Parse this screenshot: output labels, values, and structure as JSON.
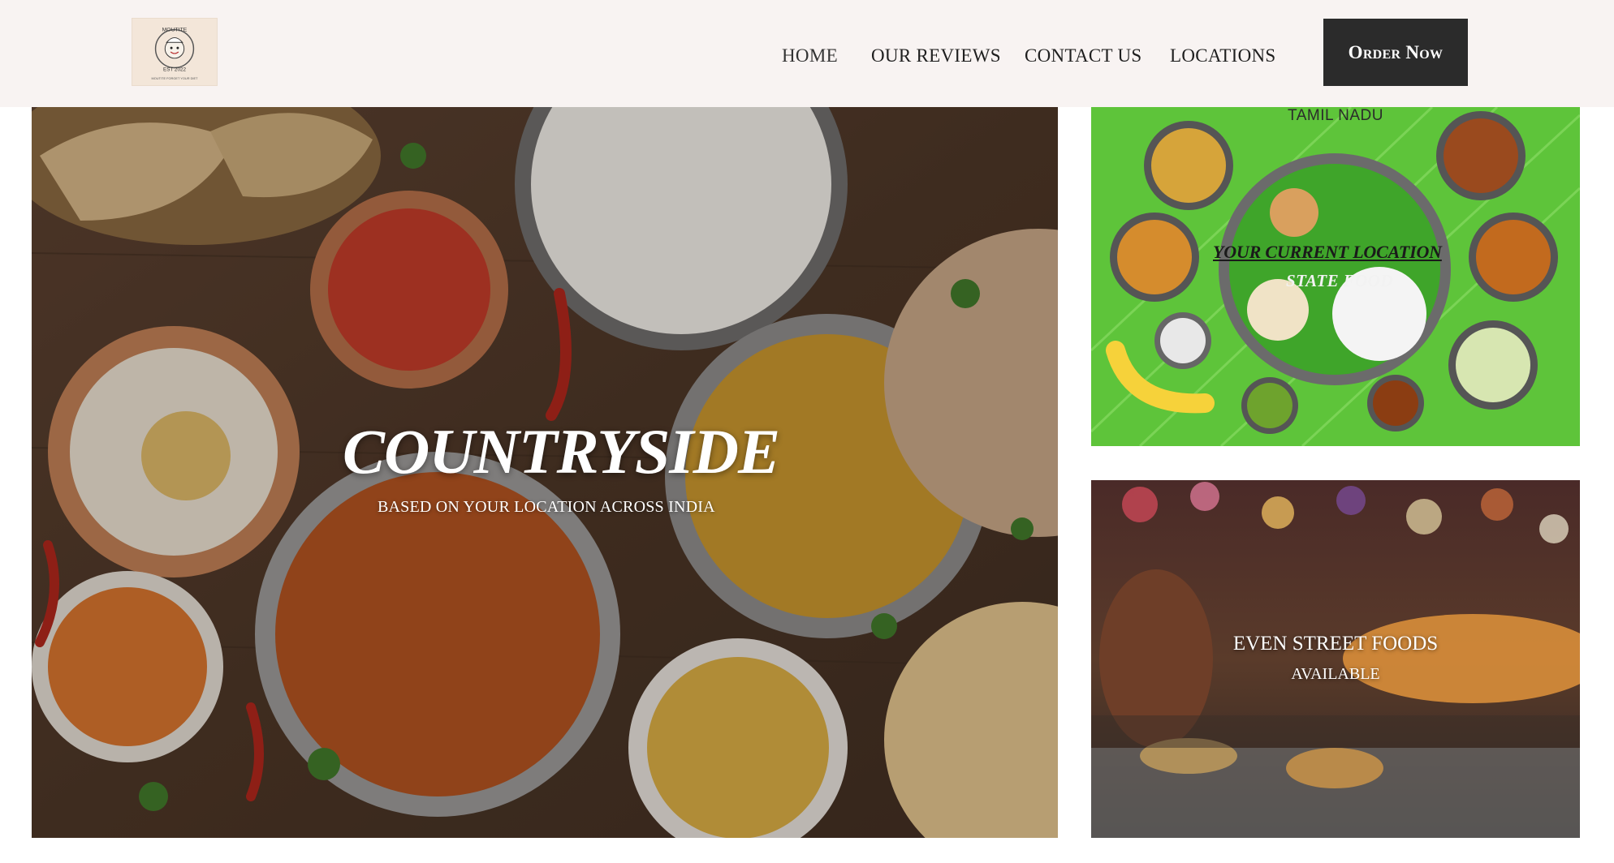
{
  "header": {
    "logo_lines": [
      "MOUTITE",
      "EST 2022",
      "MOUTITE FORGET YOUR DIET"
    ],
    "nav": [
      "HOME",
      "OUR REVIEWS",
      "CONTACT US",
      "LOCATIONS"
    ],
    "order_button": "Order Now"
  },
  "hero": {
    "title": "COUNTRYSIDE",
    "subtitle": "BASED ON YOUR LOCATION ACROSS INDIA"
  },
  "cards": [
    {
      "top_label": "TAMIL NADU",
      "title": "YOUR CURRENT LOCATION",
      "subtitle": "STATE FOOD"
    },
    {
      "title": "EVEN STREET FOODS",
      "subtitle": "AVAILABLE"
    }
  ],
  "colors": {
    "header_bg": "#f8f3f2",
    "button_bg": "#2b2b2b",
    "banana_leaf": "#5ec43a"
  }
}
